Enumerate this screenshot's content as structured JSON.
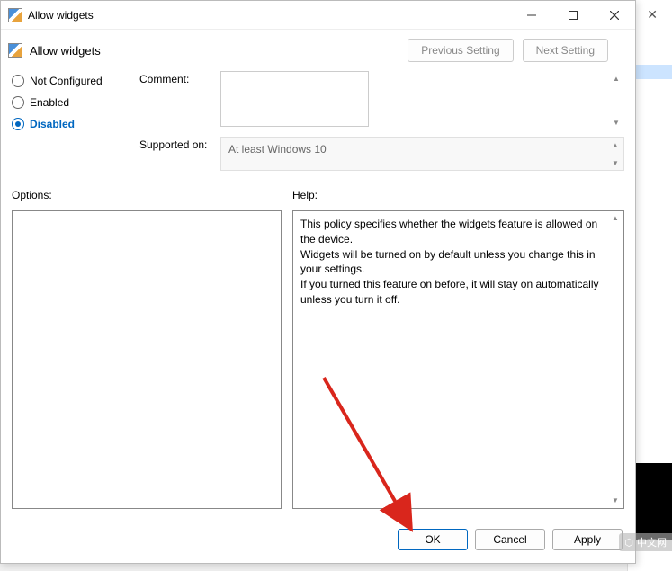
{
  "window": {
    "title": "Allow widgets",
    "header_title": "Allow widgets"
  },
  "nav": {
    "previous": "Previous Setting",
    "next": "Next Setting"
  },
  "radios": {
    "not_configured": "Not Configured",
    "enabled": "Enabled",
    "disabled": "Disabled"
  },
  "fields": {
    "comment_label": "Comment:",
    "comment_value": "",
    "supported_label": "Supported on:",
    "supported_value": "At least Windows 10"
  },
  "panels": {
    "options_label": "Options:",
    "help_label": "Help:",
    "help_text": "This policy specifies whether the widgets feature is allowed on the device.\nWidgets will be turned on by default unless you change this in your settings.\nIf you turned this feature on before, it will stay on automatically unless you turn it off."
  },
  "footer": {
    "ok": "OK",
    "cancel": "Cancel",
    "apply": "Apply"
  },
  "watermark": "中文网"
}
